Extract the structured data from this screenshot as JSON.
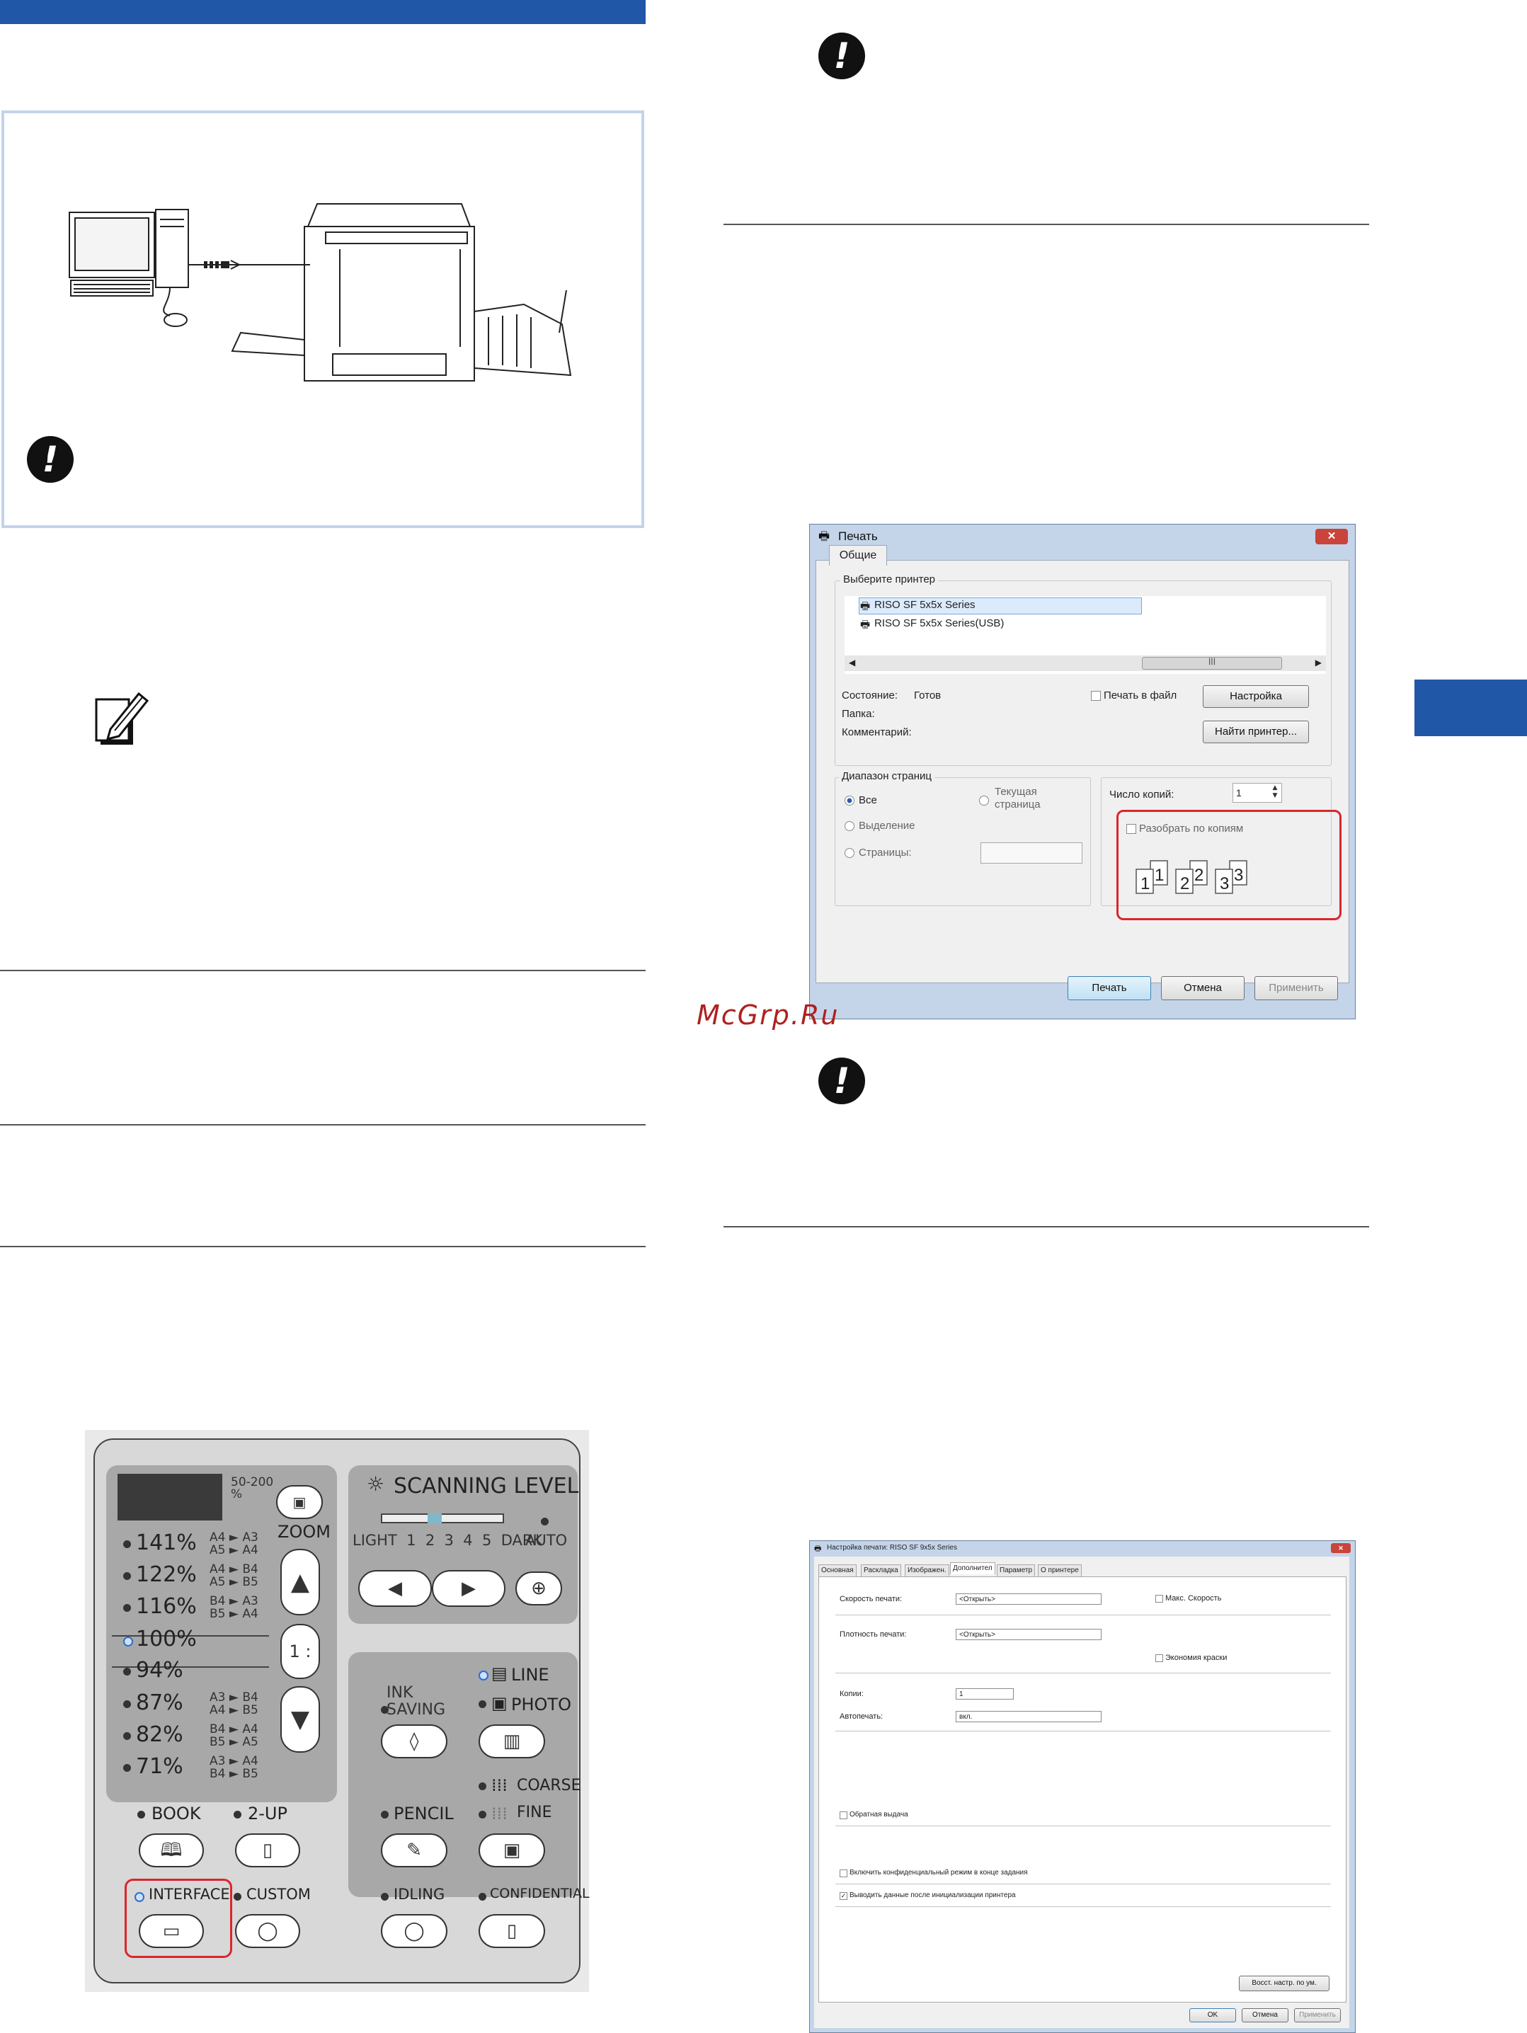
{
  "watermark": "McGrp.Ru",
  "print_dialog": {
    "title": "Печать",
    "tab": "Общие",
    "group_printer": "Выберите принтер",
    "printers": [
      "RISO SF 5x5x Series",
      "RISO SF 5x5x Series(USB)"
    ],
    "status_label": "Состояние:",
    "status_value": "Готов",
    "folder_label": "Папка:",
    "comment_label": "Комментарий:",
    "print_to_file": "Печать в файл",
    "settings_button": "Настройка",
    "find_printer_button": "Найти принтер...",
    "range_group": "Диапазон страниц",
    "range_all": "Все",
    "range_current": "Текущая\nстраница",
    "range_selection": "Выделение",
    "range_pages": "Страницы:",
    "copies_label": "Число копий:",
    "copies_value": "1",
    "collate": "Разобрать по копиям",
    "print_button": "Печать",
    "cancel_button": "Отмена",
    "apply_button": "Применить"
  },
  "settings_dialog": {
    "title": "Настройка печати: RISO SF 9x5x Series",
    "tabs": [
      "Основная",
      "Раскладка",
      "Изображен.",
      "Дополнител",
      "Параметр",
      "О принтере"
    ],
    "speed_label": "Скорость печати:",
    "speed_value": "<Открыть>",
    "max_speed": "Макс. Скорость",
    "density_label": "Плотность печати:",
    "density_value": "<Открыть>",
    "ink_saving": "Экономия краски",
    "copies_label": "Копии:",
    "copies_value": "1",
    "autoprint_label": "Автопечать:",
    "autoprint_value": "вкл.",
    "reverse_output": "Обратная выдача",
    "confidential": "Включить конфиденциальный режим в конце задания",
    "output_after_init": "Выводить данные после инициализации принтера",
    "restore_button": "Восст. настр. по ум.",
    "ok_button": "OK",
    "cancel_button": "Отмена",
    "apply_button": "Применить"
  },
  "panel": {
    "range": "50-200\n%",
    "zoom": "ZOOM",
    "one_to_one": "1 : 1",
    "percents": [
      "141%",
      "122%",
      "116%",
      "100%",
      "94%",
      "87%",
      "82%",
      "71%"
    ],
    "paper_top": [
      "A4 ► A3",
      "A4 ► B4",
      "B4 ► A3",
      "",
      "",
      "A3 ► B4",
      "B4 ► A4",
      "A3 ► A4"
    ],
    "paper_bottom": [
      "A5 ► A4",
      "A5 ► B5",
      "B5 ► A4",
      "",
      "",
      "A4 ► B5",
      "B5 ► A5",
      "B4 ► B5"
    ],
    "scanning_level": "SCANNING LEVEL",
    "levels": "LIGHT  1  2  3  4  5  DARK",
    "auto": "AUTO",
    "ink_saving": "INK\nSAVING",
    "line": "LINE",
    "photo": "PHOTO",
    "coarse": "COARSE",
    "pencil": "PENCIL",
    "fine": "FINE",
    "book": "BOOK",
    "two_up": "2-UP",
    "interface": "INTERFACE",
    "custom": "CUSTOM",
    "idling": "IDLING",
    "confidential": "CONFIDENTIAL"
  },
  "colors": {
    "accent": "#2057a7",
    "highlight": "#d9262e",
    "led": "#2a6fd1"
  }
}
